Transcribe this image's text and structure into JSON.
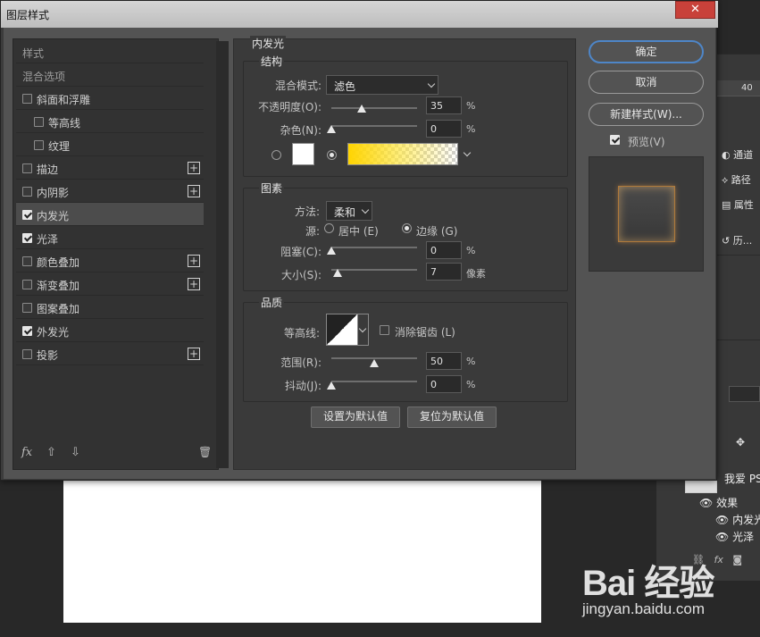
{
  "background_app": {
    "ruler_number": "40",
    "right_panel": {
      "channels": "通道",
      "paths": "路径",
      "properties": "属性",
      "history": "历..."
    },
    "layers": {
      "layer_name": "我爱 PS",
      "effects": "效果",
      "effect_inner_glow": "内发光",
      "effect_satin": "光泽"
    },
    "footer_icons": [
      "link-icon",
      "fx-icon",
      "mask-icon"
    ]
  },
  "watermark": {
    "logo": "Bai 经验",
    "url": "jingyan.baidu.com"
  },
  "dialog": {
    "title": "图层样式",
    "close_glyph": "✕",
    "styles_list": {
      "header": "样式",
      "blend_options": "混合选项",
      "items": [
        {
          "label": "斜面和浮雕",
          "checked": false,
          "plus": false,
          "indent": false
        },
        {
          "label": "等高线",
          "checked": false,
          "plus": false,
          "indent": true
        },
        {
          "label": "纹理",
          "checked": false,
          "plus": false,
          "indent": true
        },
        {
          "label": "描边",
          "checked": false,
          "plus": true,
          "indent": false
        },
        {
          "label": "内阴影",
          "checked": false,
          "plus": true,
          "indent": false
        },
        {
          "label": "内发光",
          "checked": true,
          "plus": false,
          "indent": false,
          "selected": true
        },
        {
          "label": "光泽",
          "checked": true,
          "plus": false,
          "indent": false
        },
        {
          "label": "颜色叠加",
          "checked": false,
          "plus": true,
          "indent": false
        },
        {
          "label": "渐变叠加",
          "checked": false,
          "plus": true,
          "indent": false
        },
        {
          "label": "图案叠加",
          "checked": false,
          "plus": false,
          "indent": false
        },
        {
          "label": "外发光",
          "checked": true,
          "plus": false,
          "indent": false
        },
        {
          "label": "投影",
          "checked": false,
          "plus": true,
          "indent": false
        }
      ],
      "plus_glyph": "+",
      "footer": {
        "fx": "fx",
        "up": "⇧",
        "down": "⇩",
        "trash": "🗑"
      }
    },
    "inner_glow": {
      "title": "内发光",
      "structure": {
        "title": "结构",
        "blend_mode_label": "混合模式:",
        "blend_mode_value": "滤色",
        "opacity_label": "不透明度(O):",
        "opacity_value": "35",
        "noise_label": "杂色(N):",
        "noise_value": "0",
        "percent": "%",
        "color_mode": "gradient",
        "gradient_colors": [
          "#ffd400",
          "#fff06a"
        ]
      },
      "elements": {
        "title": "图素",
        "technique_label": "方法:",
        "technique_value": "柔和",
        "source_label": "源:",
        "source_center": "居中 (E)",
        "source_edge": "边缘 (G)",
        "source_selected": "edge",
        "choke_label": "阻塞(C):",
        "choke_value": "0",
        "size_label": "大小(S):",
        "size_value": "7",
        "size_unit": "像素",
        "percent": "%"
      },
      "quality": {
        "title": "品质",
        "contour_label": "等高线:",
        "antialias_label": "消除锯齿 (L)",
        "range_label": "范围(R):",
        "range_value": "50",
        "jitter_label": "抖动(J):",
        "jitter_value": "0",
        "percent": "%"
      },
      "make_default": "设置为默认值",
      "reset_default": "复位为默认值"
    },
    "buttons": {
      "ok": "确定",
      "cancel": "取消",
      "new_style": "新建样式(W)...",
      "preview_label": "预览(V)",
      "preview_checked": true
    }
  }
}
